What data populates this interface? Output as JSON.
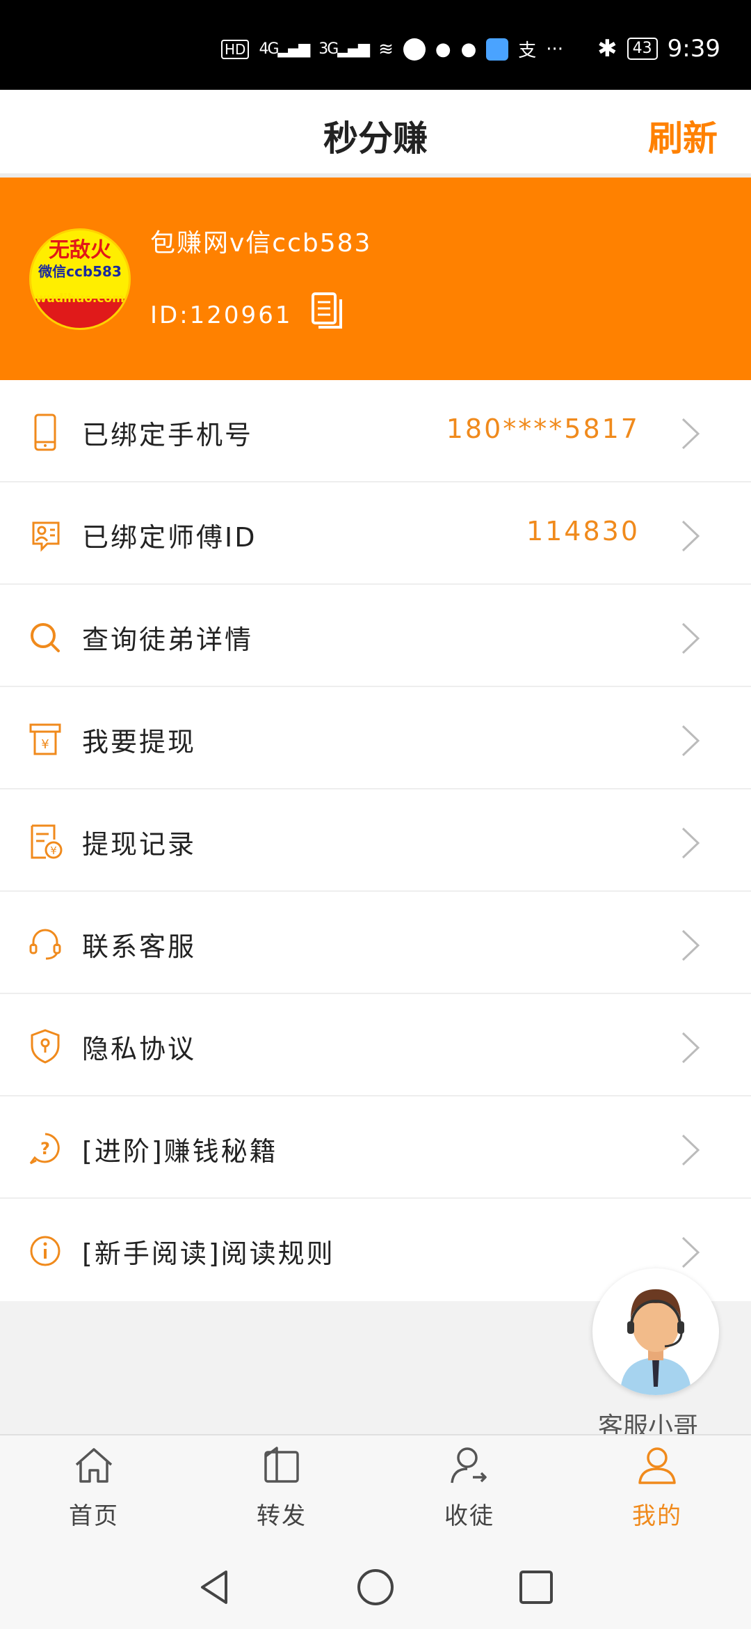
{
  "status_bar": {
    "left_indicators": [
      "HD",
      "4G",
      "3G"
    ],
    "battery": "43",
    "time": "9:39"
  },
  "header": {
    "title": "秒分赚",
    "refresh_label": "刷新"
  },
  "profile": {
    "avatar_text": {
      "line1": "无敌火",
      "line2": "微信ccb583",
      "line3": "wudihuo.com"
    },
    "name": "包赚网v信ccb583",
    "id_text": "ID:120961"
  },
  "menu": [
    {
      "label": "已绑定手机号",
      "value": "180****5817",
      "icon": "phone-icon"
    },
    {
      "label": "已绑定师傅ID",
      "value": "114830",
      "icon": "master-id-icon"
    },
    {
      "label": "查询徒弟详情",
      "value": "",
      "icon": "search-icon"
    },
    {
      "label": "我要提现",
      "value": "",
      "icon": "withdraw-icon"
    },
    {
      "label": "提现记录",
      "value": "",
      "icon": "withdraw-record-icon"
    },
    {
      "label": "联系客服",
      "value": "",
      "icon": "headset-icon"
    },
    {
      "label": "隐私协议",
      "value": "",
      "icon": "shield-icon"
    },
    {
      "label": "[进阶]赚钱秘籍",
      "value": "",
      "icon": "question-icon"
    },
    {
      "label": "[新手阅读]阅读规则",
      "value": "",
      "icon": "info-icon"
    }
  ],
  "floating_service": {
    "label": "客服小哥"
  },
  "tabbar": [
    {
      "label": "首页",
      "icon": "home-icon",
      "active": false
    },
    {
      "label": "转发",
      "icon": "book-icon",
      "active": false
    },
    {
      "label": "收徒",
      "icon": "add-user-icon",
      "active": false
    },
    {
      "label": "我的",
      "icon": "person-icon",
      "active": true
    }
  ],
  "colors": {
    "accent": "#ff8100",
    "value_text": "#f08a1c",
    "icon_orange": "#f08a1c"
  }
}
